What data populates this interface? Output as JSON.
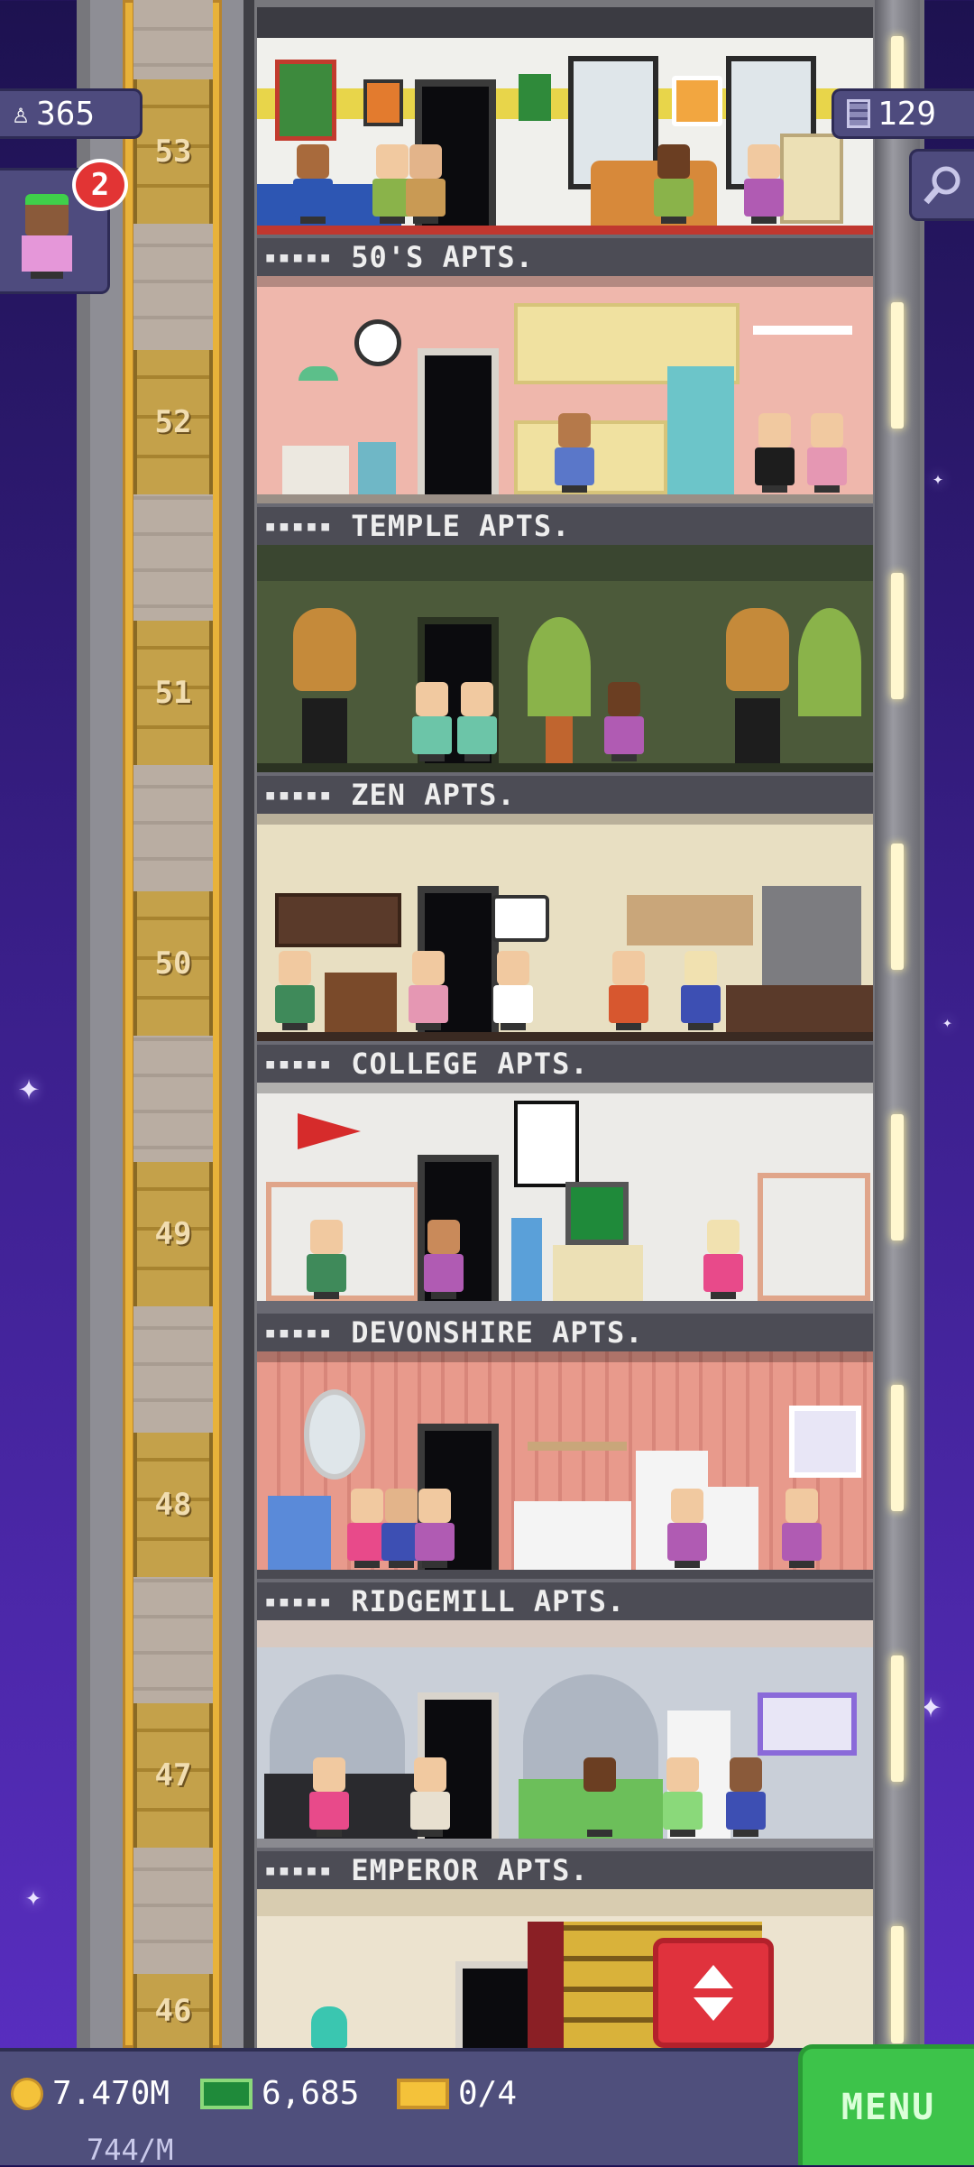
{
  "hud": {
    "population": "365",
    "population_icon": "person-icon",
    "floor_count": "129",
    "floor_count_icon": "building-icon",
    "notification_count": "2",
    "search_icon": "magnifier-icon"
  },
  "floors": [
    {
      "number": "53",
      "name": "50'S APTS.",
      "dots": "▪▪▪▪▪",
      "wall": "#f0f0ec",
      "accent": "#e8d54a"
    },
    {
      "number": "52",
      "name": "TEMPLE APTS.",
      "dots": "▪▪▪▪▪",
      "wall": "#efb7ac",
      "accent": "#f0e1a0"
    },
    {
      "number": "51",
      "name": "ZEN APTS.",
      "dots": "▪▪▪▪▪",
      "wall": "#4c5a3a",
      "accent": "#3a4630"
    },
    {
      "number": "50",
      "name": "COLLEGE APTS.",
      "dots": "▪▪▪▪▪",
      "wall": "#e8dfc2",
      "accent": "#d9c89c"
    },
    {
      "number": "49",
      "name": "DEVONSHIRE APTS.",
      "dots": "▪▪▪▪▪",
      "wall": "#ecebe8",
      "accent": "#d8d6d2"
    },
    {
      "number": "48",
      "name": "RIDGEMILL APTS.",
      "dots": "▪▪▪▪▪",
      "wall": "#e89a8c",
      "accent": "#d87e72"
    },
    {
      "number": "47",
      "name": "EMPEROR APTS.",
      "dots": "▪▪▪▪▪",
      "wall": "#c9cfd8",
      "accent": "#aeb6c2"
    },
    {
      "number": "46",
      "name": "",
      "dots": "",
      "wall": "#ece3cf",
      "accent": "#8a1f25"
    }
  ],
  "resources": {
    "coins": "7.470M",
    "coin_icon": "coin-icon",
    "bux": "6,685",
    "bux_icon": "cash-icon",
    "tickets": "0/4",
    "ticket_icon": "ticket-icon",
    "coin_rate": "744/M"
  },
  "buttons": {
    "menu": "MENU",
    "elevator": "elevator-updown-icon"
  },
  "colors": {
    "sky_top": "#1d1250",
    "sky_bottom": "#5b2fc4",
    "menu_green": "#3dc34a",
    "elevator_red": "#e0323d",
    "hud_panel": "#4e4b7e"
  }
}
